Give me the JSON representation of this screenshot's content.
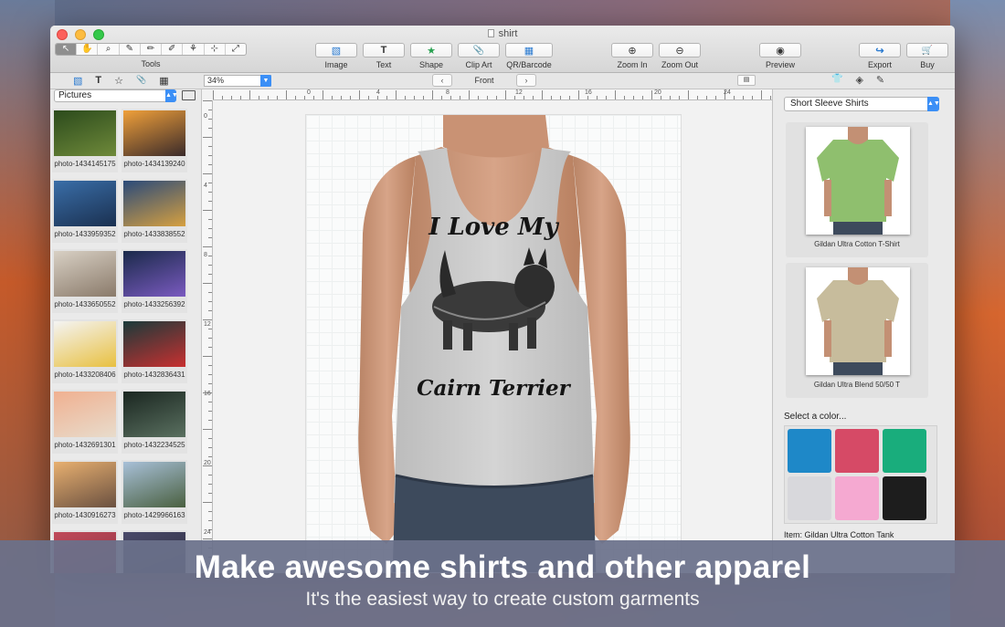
{
  "window": {
    "title": "shirt"
  },
  "toolbar": {
    "tools_label": "Tools",
    "tool_icons": [
      "↖",
      "✋",
      "⌕",
      "✎",
      "✏",
      "✐",
      "⚘",
      "⊹",
      "⤢"
    ],
    "buttons": [
      {
        "icon": "▧",
        "label": "Image"
      },
      {
        "icon": "T",
        "label": "Text"
      },
      {
        "icon": "★",
        "label": "Shape"
      },
      {
        "icon": "📎",
        "label": "Clip Art"
      },
      {
        "icon": "▦",
        "label": "QR/Barcode"
      },
      {
        "icon": "⊕",
        "label": "Zoom In"
      },
      {
        "icon": "⊖",
        "label": "Zoom Out"
      },
      {
        "icon": "◉",
        "label": "Preview"
      },
      {
        "icon": "↪",
        "label": "Export"
      },
      {
        "icon": "🛒",
        "label": "Buy"
      }
    ]
  },
  "subbar": {
    "left_icons": [
      "▧",
      "T",
      "☆",
      "📎",
      "▦"
    ],
    "zoom": "34%",
    "side": "Front",
    "right_icons": [
      "👕",
      "◈",
      "✎"
    ]
  },
  "left_panel": {
    "source": "Pictures",
    "photos": [
      {
        "caption": "photo-1434145175",
        "c1": "#2b4a1c",
        "c2": "#6f8a3a"
      },
      {
        "caption": "photo-1434139240",
        "c1": "#f0a03a",
        "c2": "#3a2a2a"
      },
      {
        "caption": "photo-1433959352",
        "c1": "#3a6ea8",
        "c2": "#1a3050"
      },
      {
        "caption": "photo-1433838552",
        "c1": "#2a4a7a",
        "c2": "#d6a040"
      },
      {
        "caption": "photo-1433650552",
        "c1": "#d8d0c4",
        "c2": "#8a7a6a"
      },
      {
        "caption": "photo-1433256392",
        "c1": "#1a2a4a",
        "c2": "#7a5ac0"
      },
      {
        "caption": "photo-1433208406",
        "c1": "#f4f4f4",
        "c2": "#e8c040"
      },
      {
        "caption": "photo-1432836431",
        "c1": "#1a3a3a",
        "c2": "#c83030"
      },
      {
        "caption": "photo-1432691301",
        "c1": "#f0b090",
        "c2": "#e8dccc"
      },
      {
        "caption": "photo-1432234525",
        "c1": "#1a2620",
        "c2": "#5a7060"
      },
      {
        "caption": "photo-1430916273",
        "c1": "#e8b070",
        "c2": "#6a5040"
      },
      {
        "caption": "photo-1429966163",
        "c1": "#a8c0d8",
        "c2": "#4a6040"
      },
      {
        "caption": "",
        "c1": "#c04a5a",
        "c2": "#8a3040"
      },
      {
        "caption": "",
        "c1": "#4a4a6a",
        "c2": "#2a2a3a"
      }
    ]
  },
  "canvas": {
    "ruler_top": [
      "0",
      "4",
      "8",
      "12",
      "16",
      "20",
      "24"
    ],
    "ruler_left": [
      "0",
      "4",
      "8",
      "12",
      "16",
      "20",
      "24"
    ],
    "design_line1": "I Love My",
    "design_line2": "Cairn Terrier"
  },
  "right_panel": {
    "category": "Short Sleeve Shirts",
    "garments": [
      {
        "caption": "Gildan Ultra Cotton T-Shirt",
        "shirt_color": "#8fbf6e"
      },
      {
        "caption": "Gildan Ultra Blend 50/50 T",
        "shirt_color": "#c7bc9c"
      }
    ],
    "color_prompt": "Select a color...",
    "swatches": [
      "#1e88c8",
      "#d64a66",
      "#19ad7c",
      "#d8d8dc",
      "#f5a9d1",
      "#1d1d1d"
    ],
    "item": "Item: Gildan Ultra Cotton Tank"
  },
  "banner": {
    "headline": "Make awesome shirts and other apparel",
    "subline": "It's the easiest way to create custom garments"
  }
}
